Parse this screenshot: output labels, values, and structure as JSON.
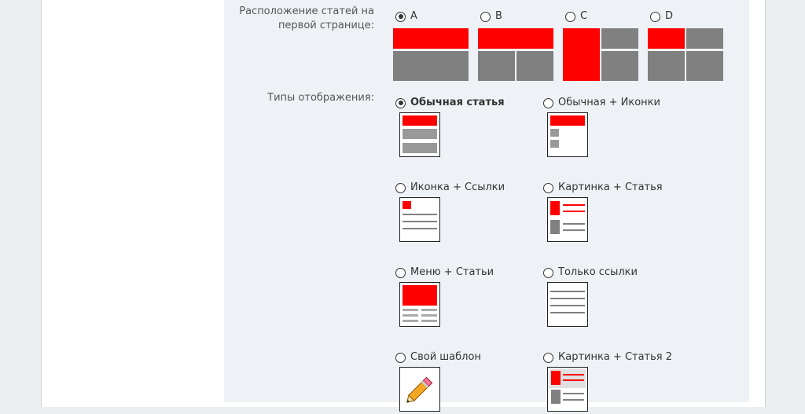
{
  "layout_section": {
    "label_line1": "Расположение статей на",
    "label_line2": "первой странице:",
    "options": [
      {
        "label": "A",
        "checked": true
      },
      {
        "label": "B",
        "checked": false
      },
      {
        "label": "C",
        "checked": false
      },
      {
        "label": "D",
        "checked": false
      }
    ]
  },
  "display_section": {
    "label": "Типы отображения:",
    "options": [
      {
        "label": "Обычная статья",
        "checked": true,
        "icon": "regular-article-icon"
      },
      {
        "label": "Обычная + Иконки",
        "checked": false,
        "icon": "regular-icons-icon"
      },
      {
        "label": "Иконка + Ссылки",
        "checked": false,
        "icon": "icon-links-icon"
      },
      {
        "label": "Картинка + Статья",
        "checked": false,
        "icon": "picture-article-icon"
      },
      {
        "label": "Меню + Статьи",
        "checked": false,
        "icon": "menu-articles-icon"
      },
      {
        "label": "Только ссылки",
        "checked": false,
        "icon": "links-only-icon"
      },
      {
        "label": "Свой шаблон",
        "checked": false,
        "icon": "pencil-icon"
      },
      {
        "label": "Картинка + Статья 2",
        "checked": false,
        "icon": "picture-article-2-icon"
      }
    ]
  },
  "colors": {
    "accent": "#ff0000",
    "block": "#808080",
    "panel": "#eef2f6"
  }
}
